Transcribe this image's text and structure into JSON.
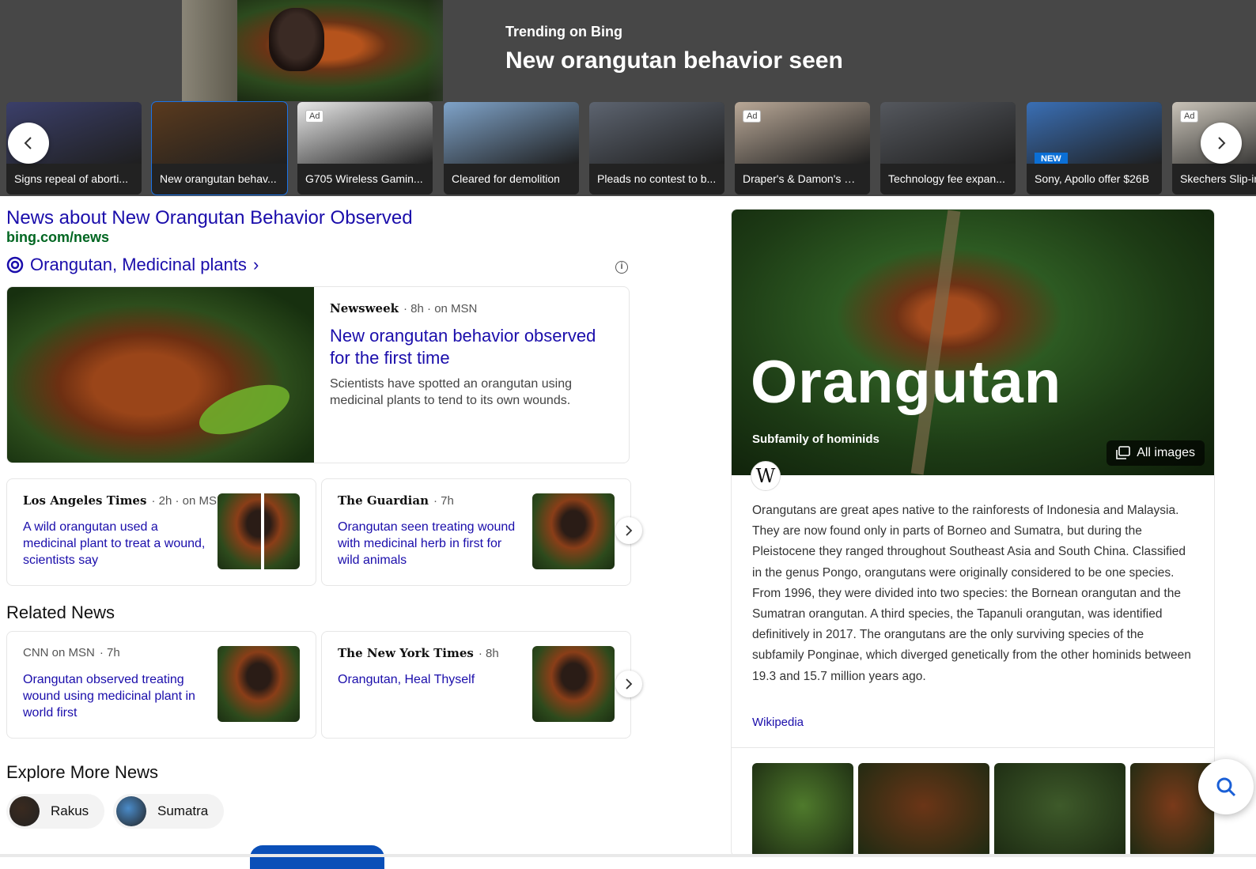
{
  "banner": {
    "kicker": "Trending on Bing",
    "title": "New orangutan behavior seen",
    "cards": [
      {
        "label": "Signs repeal of aborti...",
        "ad": "",
        "badge": "",
        "active": false,
        "color": "#3b3f6a"
      },
      {
        "label": "New orangutan behav...",
        "ad": "",
        "badge": "",
        "active": true,
        "color": "#5a3a1e"
      },
      {
        "label": "G705 Wireless Gamin...",
        "ad": "Ad",
        "badge": "",
        "active": false,
        "color": "#e8e8e8"
      },
      {
        "label": "Cleared for demolition",
        "ad": "",
        "badge": "",
        "active": false,
        "color": "#7fa3c9"
      },
      {
        "label": "Pleads no contest to b...",
        "ad": "",
        "badge": "",
        "active": false,
        "color": "#5d6470"
      },
      {
        "label": "Draper's & Damon's W...",
        "ad": "Ad",
        "badge": "",
        "active": false,
        "color": "#b9a897"
      },
      {
        "label": "Technology fee expan...",
        "ad": "",
        "badge": "",
        "active": false,
        "color": "#55585e"
      },
      {
        "label": "Sony, Apollo offer $26B",
        "ad": "",
        "badge": "NEW",
        "active": false,
        "color": "#3a6fb5"
      },
      {
        "label": "Skechers Slip-ins",
        "ad": "Ad",
        "badge": "",
        "active": false,
        "color": "#c9c3b8"
      }
    ]
  },
  "news": {
    "title": "News about New Orangutan Behavior Observed",
    "url": "bing.com/news",
    "topic": "Orangutan, Medicinal plants",
    "main": {
      "publisher": "Newsweek",
      "meta": "· 8h · on MSN",
      "headline": "New orangutan behavior observed for the first time",
      "snippet": "Scientists have spotted an orangutan using medicinal plants to tend to its own wounds."
    },
    "sub": [
      {
        "publisher": "Los Angeles Times",
        "meta": "· 2h · on MSN",
        "headline": "A wild orangutan used a medicinal plant to treat a wound, scientists say"
      },
      {
        "publisher": "The Guardian",
        "meta": "· 7h",
        "headline": "Orangutan seen treating wound with medicinal herb in first for wild animals"
      }
    ],
    "related_title": "Related News",
    "related": [
      {
        "publisher": "CNN on MSN",
        "meta": "· 7h",
        "headline": "Orangutan observed treating wound using medicinal plant in world first"
      },
      {
        "publisher": "The New York Times",
        "meta": "· 8h",
        "headline": "Orangutan, Heal Thyself"
      }
    ],
    "explore_title": "Explore More News",
    "chips": [
      {
        "label": "Rakus",
        "color": "#3a2a1f"
      },
      {
        "label": "Sumatra",
        "color": "#4a8bc9"
      }
    ]
  },
  "kp": {
    "name": "Orangutan",
    "subtitle": "Subfamily of hominids",
    "all_images": "All images",
    "wiki_letter": "W",
    "description": "Orangutans are great apes native to the rainforests of Indonesia and Malaysia. They are now found only in parts of Borneo and Sumatra, but during the Pleistocene they ranged throughout Southeast Asia and South China. Classified in the genus Pongo, orangutans were originally considered to be one species. From 1996, they were divided into two species: the Bornean orangutan and the Sumatran orangutan. A third species, the Tapanuli orangutan, was identified definitively in 2017. The orangutans are the only surviving species of the subfamily Ponginae, which diverged genetically from the other hominids between 19.3 and 15.7 million years ago.",
    "source": "Wikipedia",
    "thumb_colors": [
      "#4f7a2c",
      "#6b3517",
      "#3e5a2a",
      "#7a3a1a"
    ]
  },
  "icons": {
    "prev": "chevron-left-icon",
    "next": "chevron-right-icon",
    "search": "search-icon",
    "info": "info-icon",
    "gallery": "gallery-icon",
    "topic": "topic-icon"
  }
}
